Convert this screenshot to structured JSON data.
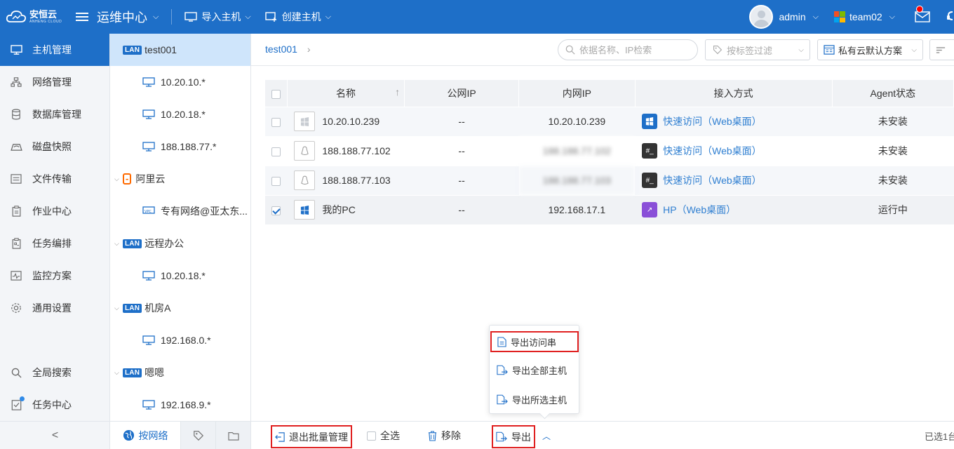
{
  "colors": {
    "primary": "#1e6fc8",
    "highlight_border": "#e02020",
    "selected_row": "#cfe5fb"
  },
  "header": {
    "logo_text": "安恒云",
    "logo_subtext": "ANHENG CLOUD",
    "app_title": "运维中心",
    "import_label": "导入主机",
    "create_label": "创建主机",
    "user": "admin",
    "team": "team02"
  },
  "nav": {
    "items": [
      {
        "label": "主机管理",
        "icon": "monitor-icon"
      },
      {
        "label": "网络管理",
        "icon": "network-icon"
      },
      {
        "label": "数据库管理",
        "icon": "database-icon"
      },
      {
        "label": "磁盘快照",
        "icon": "disk-icon"
      },
      {
        "label": "文件传输",
        "icon": "file-transfer-icon"
      },
      {
        "label": "作业中心",
        "icon": "clipboard-icon"
      },
      {
        "label": "任务编排",
        "icon": "task-icon"
      },
      {
        "label": "监控方案",
        "icon": "monitor-chart-icon"
      },
      {
        "label": "通用设置",
        "icon": "gear-icon"
      }
    ],
    "search_label": "全局搜索",
    "task_center_label": "任务中心"
  },
  "tree": {
    "nodes": [
      {
        "type": "group",
        "badge": "LAN",
        "label": "test001"
      },
      {
        "type": "leaf",
        "label": "10.20.10.*"
      },
      {
        "type": "leaf",
        "label": "10.20.18.*"
      },
      {
        "type": "leaf",
        "label": "188.188.77.*"
      },
      {
        "type": "group",
        "badge": "aliyun",
        "label": "阿里云"
      },
      {
        "type": "leaf",
        "label": "专有网络@亚太东..."
      },
      {
        "type": "group",
        "badge": "LAN",
        "label": "远程办公"
      },
      {
        "type": "leaf",
        "label": "10.20.18.*"
      },
      {
        "type": "group",
        "badge": "LAN",
        "label": "机房A"
      },
      {
        "type": "leaf",
        "label": "192.168.0.*"
      },
      {
        "type": "group",
        "badge": "LAN",
        "label": "嗯嗯"
      },
      {
        "type": "leaf",
        "label": "192.168.9.*"
      }
    ],
    "lan_badge": "LAN",
    "by_network_label": "按网络"
  },
  "main": {
    "breadcrumb": "test001",
    "search_placeholder": "依据名称、IP检索",
    "tag_filter_placeholder": "按标签过滤",
    "scheme_label": "私有云默认方案",
    "columns": [
      "名称",
      "公网IP",
      "内网IP",
      "接入方式",
      "Agent状态"
    ],
    "rows": [
      {
        "name": "10.20.10.239",
        "os": "windows",
        "public_ip": "--",
        "private_ip": "10.20.10.239",
        "access": "快速访问（Web桌面）",
        "access_type": "rdp",
        "agent": "未安装",
        "checked": false
      },
      {
        "name": "188.188.77.102",
        "os": "linux",
        "public_ip": "--",
        "private_ip": "188.188.77.102",
        "access": "快速访问（Web桌面）",
        "access_type": "ssh",
        "agent": "未安装",
        "checked": false
      },
      {
        "name": "188.188.77.103",
        "os": "linux",
        "public_ip": "--",
        "private_ip": "188.188.77.103",
        "access": "快速访问（Web桌面）",
        "access_type": "ssh",
        "agent": "未安装",
        "checked": false
      },
      {
        "name": "我的PC",
        "os": "windows",
        "public_ip": "--",
        "private_ip": "192.168.17.1",
        "access": "HP（Web桌面）",
        "access_type": "hp",
        "agent": "运行中",
        "checked": true
      }
    ]
  },
  "export_menu": {
    "items": [
      "导出访问串",
      "导出全部主机",
      "导出所选主机"
    ]
  },
  "actions": {
    "exit_batch": "退出批量管理",
    "select_all": "全选",
    "remove": "移除",
    "export": "导出",
    "selected_count": "已选1台"
  }
}
